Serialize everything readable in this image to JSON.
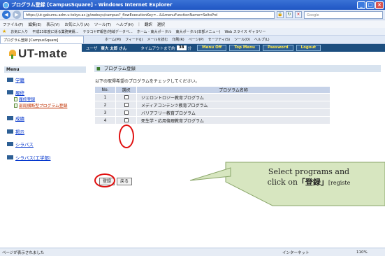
{
  "window": {
    "title": "プログラム登録 [CampusSquare] - Windows Internet Explorer"
  },
  "browser": {
    "url": "https://ut-gakumu.adm.u-tokyo.ac.jp/websys/campus?_flowExecutionKey=...&&menuFunctionName=SeltoPrd",
    "search_placeholder": "Google",
    "menu": [
      "ファイル(F)",
      "編集(E)",
      "表示(V)",
      "お気に入り(A)",
      "ツール(T)",
      "ヘルプ(H)"
    ],
    "menu_extra": [
      "翻訳",
      "選択"
    ],
    "favorites": [
      "お気に入り",
      "平成23年度に係る業務実績...",
      "テラコヤIT報告(地域データベ...",
      "ホーム - 東大ポータル",
      "東大ポータル(本部メニュー)",
      "Web スライス ギャラリー"
    ],
    "tab_label": "プログラム登録 [CampusSquare]",
    "commands": [
      "ホーム(M)",
      "フィード(J)",
      "メールを読む",
      "印刷(R)",
      "ページ(P)",
      "セーフティ(S)",
      "ツール(O)",
      "ヘルプ(L)"
    ],
    "status_left": "ページが表示されました",
    "status_zone": "インターネット",
    "zoom": "110%"
  },
  "app": {
    "logo": "UT-mate",
    "user_label": "ユーザ",
    "user_name": "東大 太郎 さん",
    "timeout_label": "タイムアウトまで約",
    "timeout_value": "38",
    "timeout_unit": "分",
    "buttons": {
      "menu_off": "Menu Off",
      "top_menu": "Top Menu",
      "password": "Password",
      "logout": "Logout"
    }
  },
  "sidebar": {
    "menu_header": "Menu",
    "items": [
      {
        "label": "学籍"
      },
      {
        "label": "履修"
      },
      {
        "label": "成績"
      },
      {
        "label": "掲示"
      },
      {
        "label": "シラバス"
      },
      {
        "label": "シラバス(工学部)"
      }
    ],
    "sub_items": [
      {
        "label": "履修登録"
      },
      {
        "label": "部局横断型プログラム登録"
      }
    ]
  },
  "main": {
    "title": "プログラム登録",
    "instruction": "以下の取得希望のプログラムをチェックしてください。",
    "table": {
      "headers": [
        "No.",
        "選択",
        "プログラム名称"
      ],
      "rows": [
        {
          "no": "1",
          "name": "ジェロントロジー教育プログラム"
        },
        {
          "no": "2",
          "name": "メディアコンテンツ教育プログラム"
        },
        {
          "no": "3",
          "name": "バリアフリー教育プログラム"
        },
        {
          "no": "4",
          "name": "死生学・応用倫理教育プログラム"
        }
      ]
    },
    "register_button": "登録",
    "back_button": "戻る"
  },
  "callout": {
    "line1": "Select programs and",
    "line2_prefix": "click on",
    "line2_bold": "「登録」",
    "line2_small": "[registe"
  },
  "colors": {
    "annotation": "#e01010",
    "callout_fill": "#d7e6c0",
    "app_nav": "#1c4e7f",
    "nav_button_text": "#ffe94a"
  }
}
